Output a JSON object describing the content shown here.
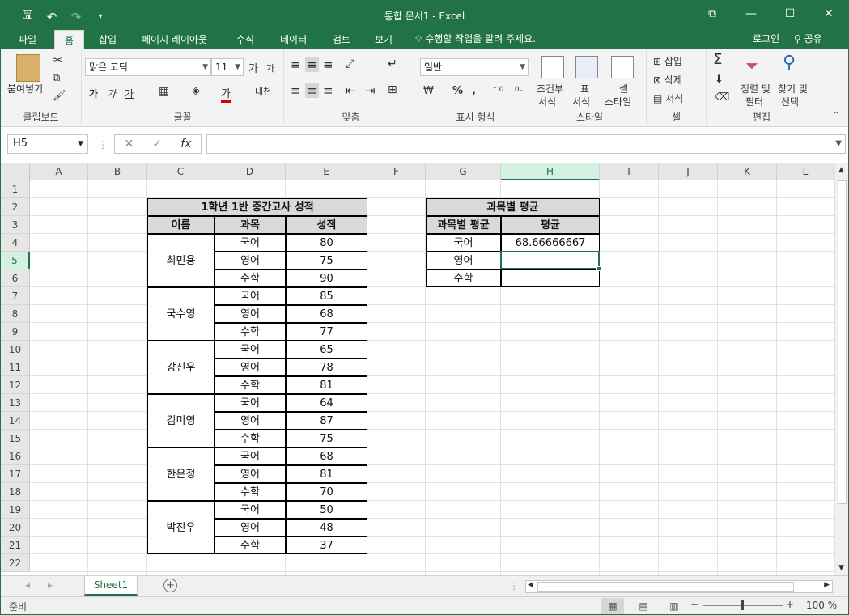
{
  "window": {
    "title": "통합 문서1  -  Excel"
  },
  "ribbon_tabs": [
    "파일",
    "홈",
    "삽입",
    "페이지 레이아웃",
    "수식",
    "데이터",
    "검토",
    "보기"
  ],
  "tell_me": "수행할 작업을 알려 주세요.",
  "login": "로그인",
  "share": "공유",
  "ribbon": {
    "clipboard": {
      "paste": "붙여넣기",
      "label": "클립보드"
    },
    "font": {
      "name": "맑은 고딕",
      "size": "11",
      "label": "글꼴",
      "bold": "가",
      "italic": "가",
      "underline": "가",
      "grow": "가",
      "shrink": "가",
      "fontcolor": "가",
      "phonetic": "내천"
    },
    "alignment": {
      "label": "맞춤"
    },
    "number": {
      "format": "일반",
      "label": "표시 형식",
      "percent": "%",
      "comma": ","
    },
    "styles": {
      "conditional_1": "조건부",
      "conditional_2": "서식",
      "table_1": "표",
      "table_2": "서식",
      "cell_1": "셀",
      "cell_2": "스타일",
      "label": "스타일"
    },
    "cells": {
      "insert": "삽입",
      "delete": "삭제",
      "format": "서식",
      "label": "셀"
    },
    "editing": {
      "sort_1": "정렬 및",
      "sort_2": "필터",
      "find_1": "찾기 및",
      "find_2": "선택",
      "label": "편집",
      "sigma": "Σ"
    }
  },
  "namebox": "H5",
  "formula": "",
  "columns": [
    "A",
    "B",
    "C",
    "D",
    "E",
    "F",
    "G",
    "H",
    "I",
    "J",
    "K",
    "L"
  ],
  "rows": [
    "1",
    "2",
    "3",
    "4",
    "5",
    "6",
    "7",
    "8",
    "9",
    "10",
    "11",
    "12",
    "13",
    "14",
    "15",
    "16",
    "17",
    "18",
    "19",
    "20",
    "21",
    "22"
  ],
  "table1": {
    "title": "1학년 1반 중간고사 성적",
    "headers": [
      "이름",
      "과목",
      "성적"
    ],
    "students": [
      {
        "name": "최민용",
        "subjects": [
          "국어",
          "영어",
          "수학"
        ],
        "scores": [
          "80",
          "75",
          "90"
        ]
      },
      {
        "name": "국수영",
        "subjects": [
          "국어",
          "영어",
          "수학"
        ],
        "scores": [
          "85",
          "68",
          "77"
        ]
      },
      {
        "name": "강진우",
        "subjects": [
          "국어",
          "영어",
          "수학"
        ],
        "scores": [
          "65",
          "78",
          "81"
        ]
      },
      {
        "name": "김미영",
        "subjects": [
          "국어",
          "영어",
          "수학"
        ],
        "scores": [
          "64",
          "87",
          "75"
        ]
      },
      {
        "name": "한은정",
        "subjects": [
          "국어",
          "영어",
          "수학"
        ],
        "scores": [
          "68",
          "81",
          "70"
        ]
      },
      {
        "name": "박진우",
        "subjects": [
          "국어",
          "영어",
          "수학"
        ],
        "scores": [
          "50",
          "48",
          "37"
        ]
      }
    ]
  },
  "table2": {
    "title": "과목별 평균",
    "headers": [
      "과목별 평균",
      "평균"
    ],
    "rows": [
      {
        "subject": "국어",
        "avg": "68.66666667"
      },
      {
        "subject": "영어",
        "avg": ""
      },
      {
        "subject": "수학",
        "avg": ""
      }
    ]
  },
  "sheet_tab": "Sheet1",
  "status": "준비",
  "zoom": "100 %",
  "accent_color": "#217346"
}
